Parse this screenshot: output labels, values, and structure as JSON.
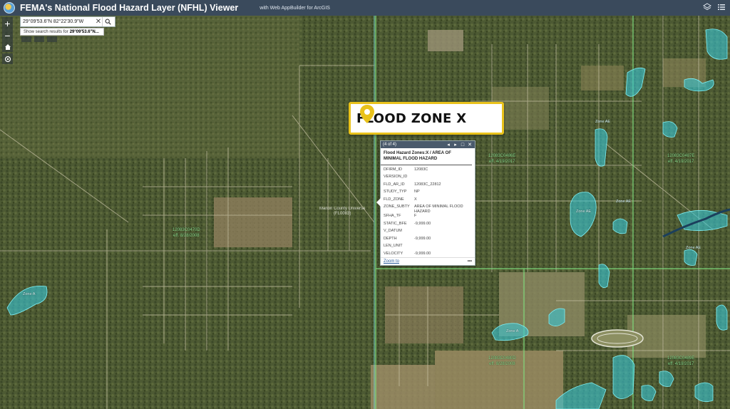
{
  "header": {
    "title": "FEMA's National Flood Hazard Layer (NFHL) Viewer",
    "subtitle": "with Web AppBuilder for ArcGIS"
  },
  "search": {
    "value": "29°09'53.6\"N 82°22'30.9\"W",
    "suggestion_prefix": "Show search results for",
    "suggestion_term": "29°09'53.6\"N..."
  },
  "zoom": {
    "in_label": "+",
    "out_label": "−"
  },
  "callout": {
    "text": "FLOOD ZONE X"
  },
  "popup": {
    "count": "(4 of 4)",
    "title": "Flood Hazard Zones:X / AREA OF MINIMAL FLOOD HAZARD",
    "attributes": [
      {
        "key": "DFIRM_ID",
        "value": "12083C"
      },
      {
        "key": "VERSION_ID",
        "value": ""
      },
      {
        "key": "FLD_AR_ID",
        "value": "12083C_22812"
      },
      {
        "key": "STUDY_TYP",
        "value": "NP"
      },
      {
        "key": "FLD_ZONE",
        "value": "X"
      },
      {
        "key": "ZONE_SUBTY",
        "value": "AREA OF MINIMAL FLOOD HAZARD"
      },
      {
        "key": "SFHA_TF",
        "value": "F"
      },
      {
        "key": "STATIC_BFE",
        "value": "-9,999.00"
      },
      {
        "key": "V_DATUM",
        "value": ""
      },
      {
        "key": "DEPTH",
        "value": "-9,999.00"
      },
      {
        "key": "LEN_UNIT",
        "value": ""
      },
      {
        "key": "VELOCITY",
        "value": "-9,999.00"
      }
    ],
    "zoom_to": "Zoom to",
    "more": "•••"
  },
  "map_labels": {
    "panel_0470": {
      "id": "12083C0470D",
      "eff": "eff. 8/28/2008"
    },
    "panel_0486": {
      "id": "12083C0486E",
      "eff": "eff. 4/19/2017"
    },
    "panel_0487": {
      "id": "12083C0487E",
      "eff": "eff. 4/19/2017"
    },
    "panel_0480": {
      "id": "12083C0480D",
      "eff": "eff. 8/28/2008"
    },
    "panel_0489": {
      "id": "12083C0489E",
      "eff": "eff. 4/19/2017"
    },
    "zone_a_1": "Zone A",
    "zone_a_2": "Zone A",
    "zone_ae_1": "Zone AE",
    "zone_ae_2": "Zone AE",
    "zone_ae_3": "Zone AE",
    "zone_ae_4": "Zone AE",
    "place": "Marion County Universe\n(FL0083)"
  },
  "colors": {
    "header": "#3a4a5c",
    "callout_border": "#e9c21b",
    "flood_zone_fill": "#38c7d6",
    "panel_line": "#7fe27f",
    "boundary_line": "#6fd3cf"
  }
}
